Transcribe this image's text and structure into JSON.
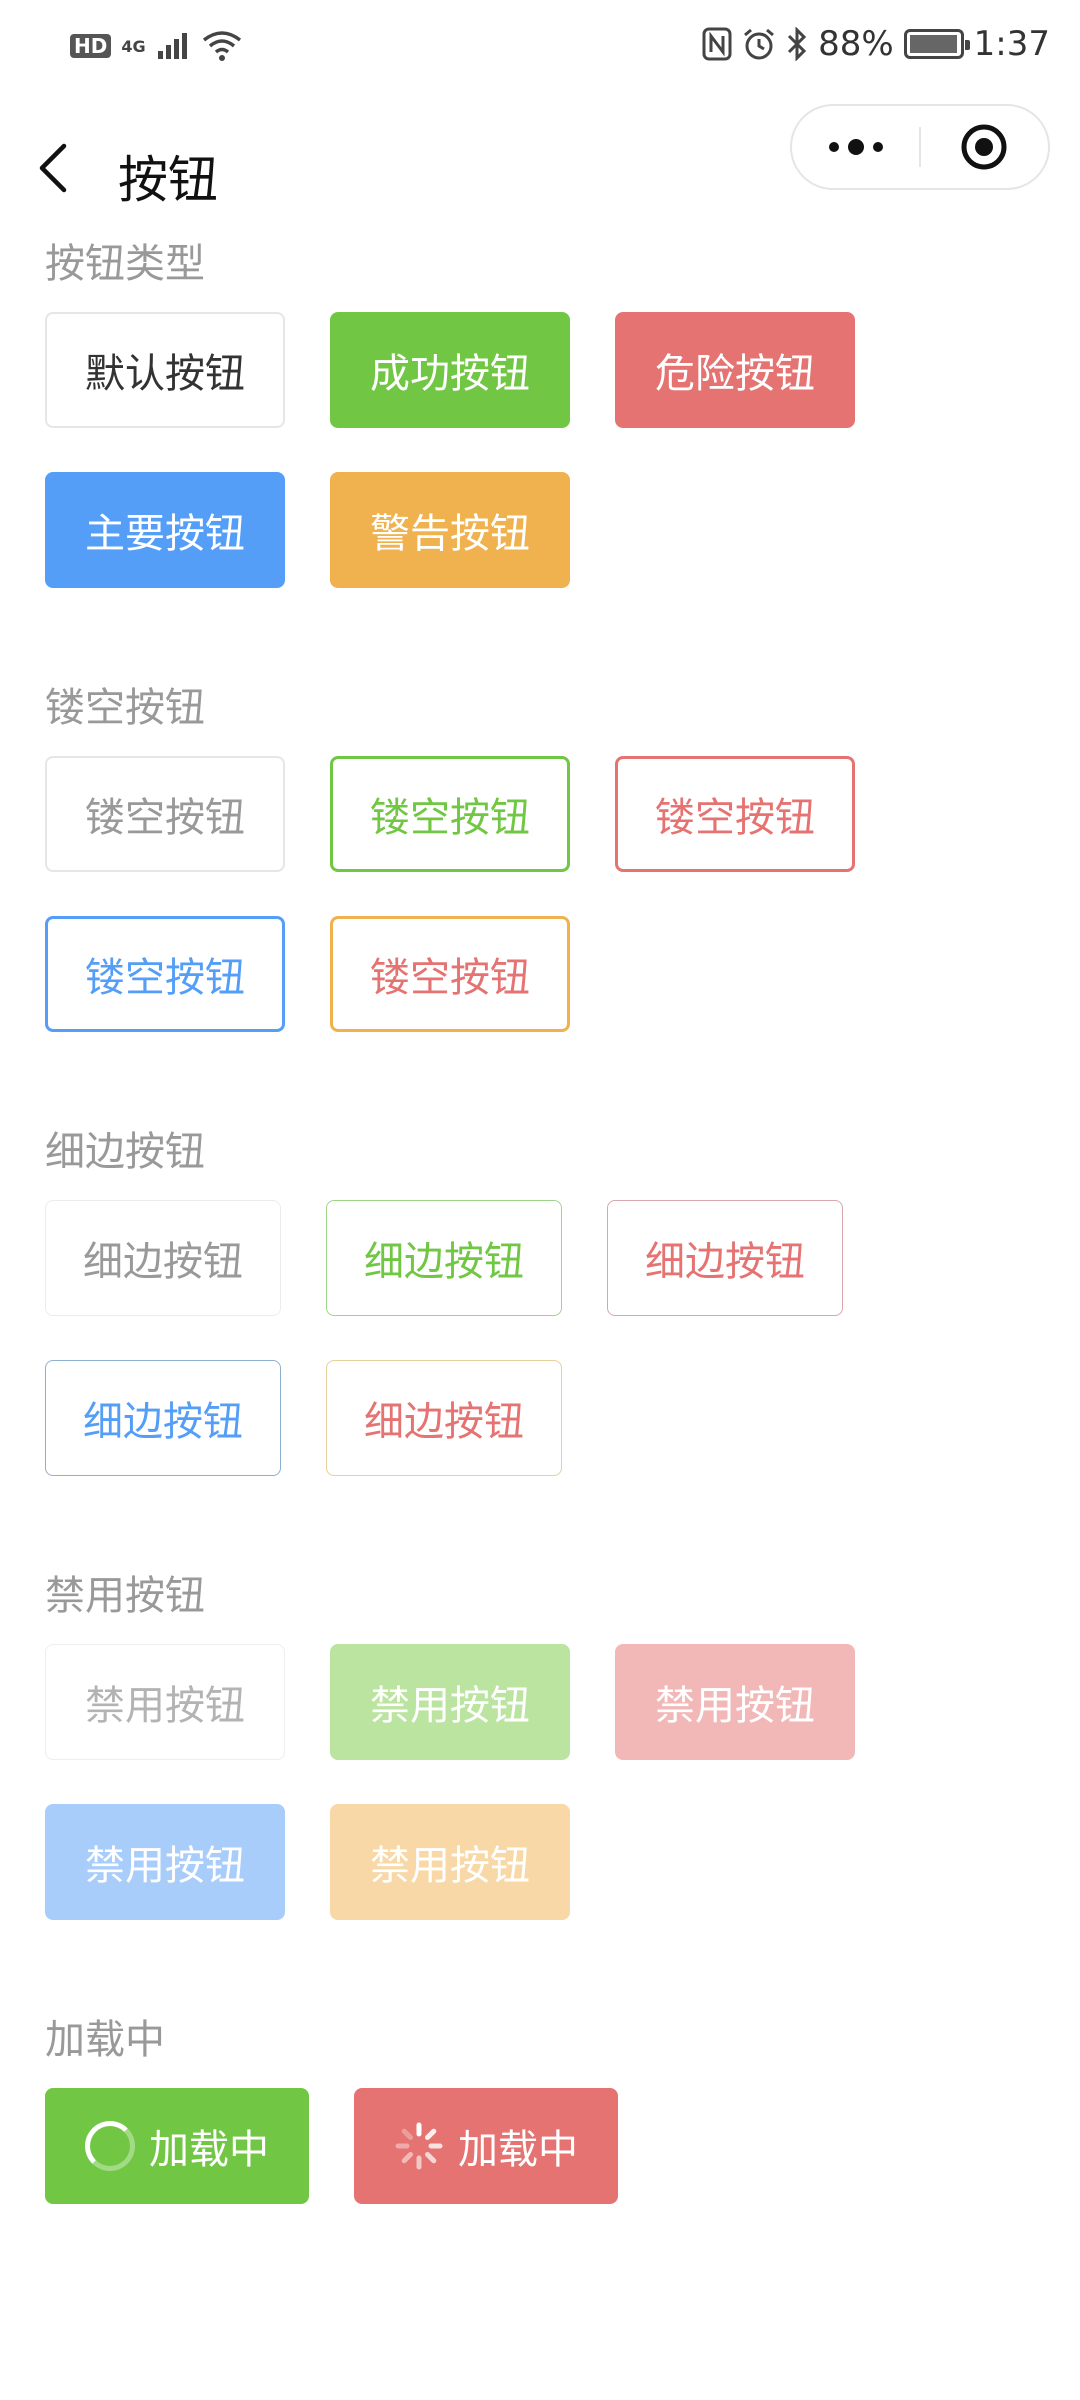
{
  "status_bar": {
    "network_badge": "HD",
    "network_type": "4G",
    "battery_percent": "88%",
    "battery_level": 0.88,
    "time": "1:37",
    "icons": [
      "hd-icon",
      "signal-icon",
      "wifi-icon",
      "nfc-icon",
      "alarm-icon",
      "bluetooth-icon",
      "battery-icon"
    ]
  },
  "nav": {
    "title": "按钮",
    "back_icon": "back-chevron-icon",
    "more_icon": "more-dots-icon",
    "close_icon": "target-icon"
  },
  "sections": {
    "types": {
      "title": "按钮类型",
      "buttons": [
        "默认按钮",
        "成功按钮",
        "危险按钮",
        "主要按钮",
        "警告按钮"
      ]
    },
    "plain": {
      "title": "镂空按钮",
      "buttons": [
        "镂空按钮",
        "镂空按钮",
        "镂空按钮",
        "镂空按钮",
        "镂空按钮"
      ]
    },
    "hairline": {
      "title": "细边按钮",
      "buttons": [
        "细边按钮",
        "细边按钮",
        "细边按钮",
        "细边按钮",
        "细边按钮"
      ]
    },
    "disabled": {
      "title": "禁用按钮",
      "buttons": [
        "禁用按钮",
        "禁用按钮",
        "禁用按钮",
        "禁用按钮",
        "禁用按钮"
      ]
    },
    "loading": {
      "title": "加载中",
      "buttons": [
        "加载中",
        "加载中"
      ]
    }
  },
  "colors": {
    "success": "#71c744",
    "danger": "#e57372",
    "primary": "#549ef8",
    "warning": "#efb24f",
    "section_title": "#999999"
  }
}
